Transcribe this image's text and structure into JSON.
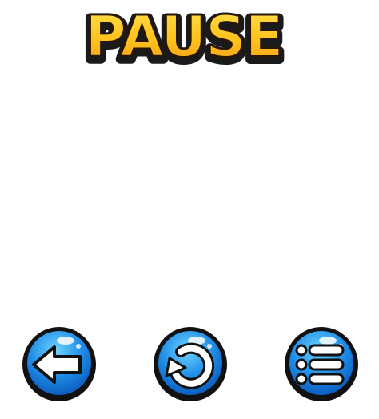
{
  "screen": {
    "title": "PAUSE"
  },
  "buttons": [
    {
      "id": "back",
      "icon": "back-arrow-icon"
    },
    {
      "id": "restart",
      "icon": "restart-icon"
    },
    {
      "id": "menu",
      "icon": "list-menu-icon"
    }
  ],
  "colors": {
    "title_fill_top": "#ffe14d",
    "title_fill_bottom": "#f39a16",
    "title_outline": "#1a1a1a",
    "button_light": "#5cc8ff",
    "button_dark": "#0a63c9",
    "button_outline": "#111111",
    "icon_fill": "#ffffff"
  }
}
